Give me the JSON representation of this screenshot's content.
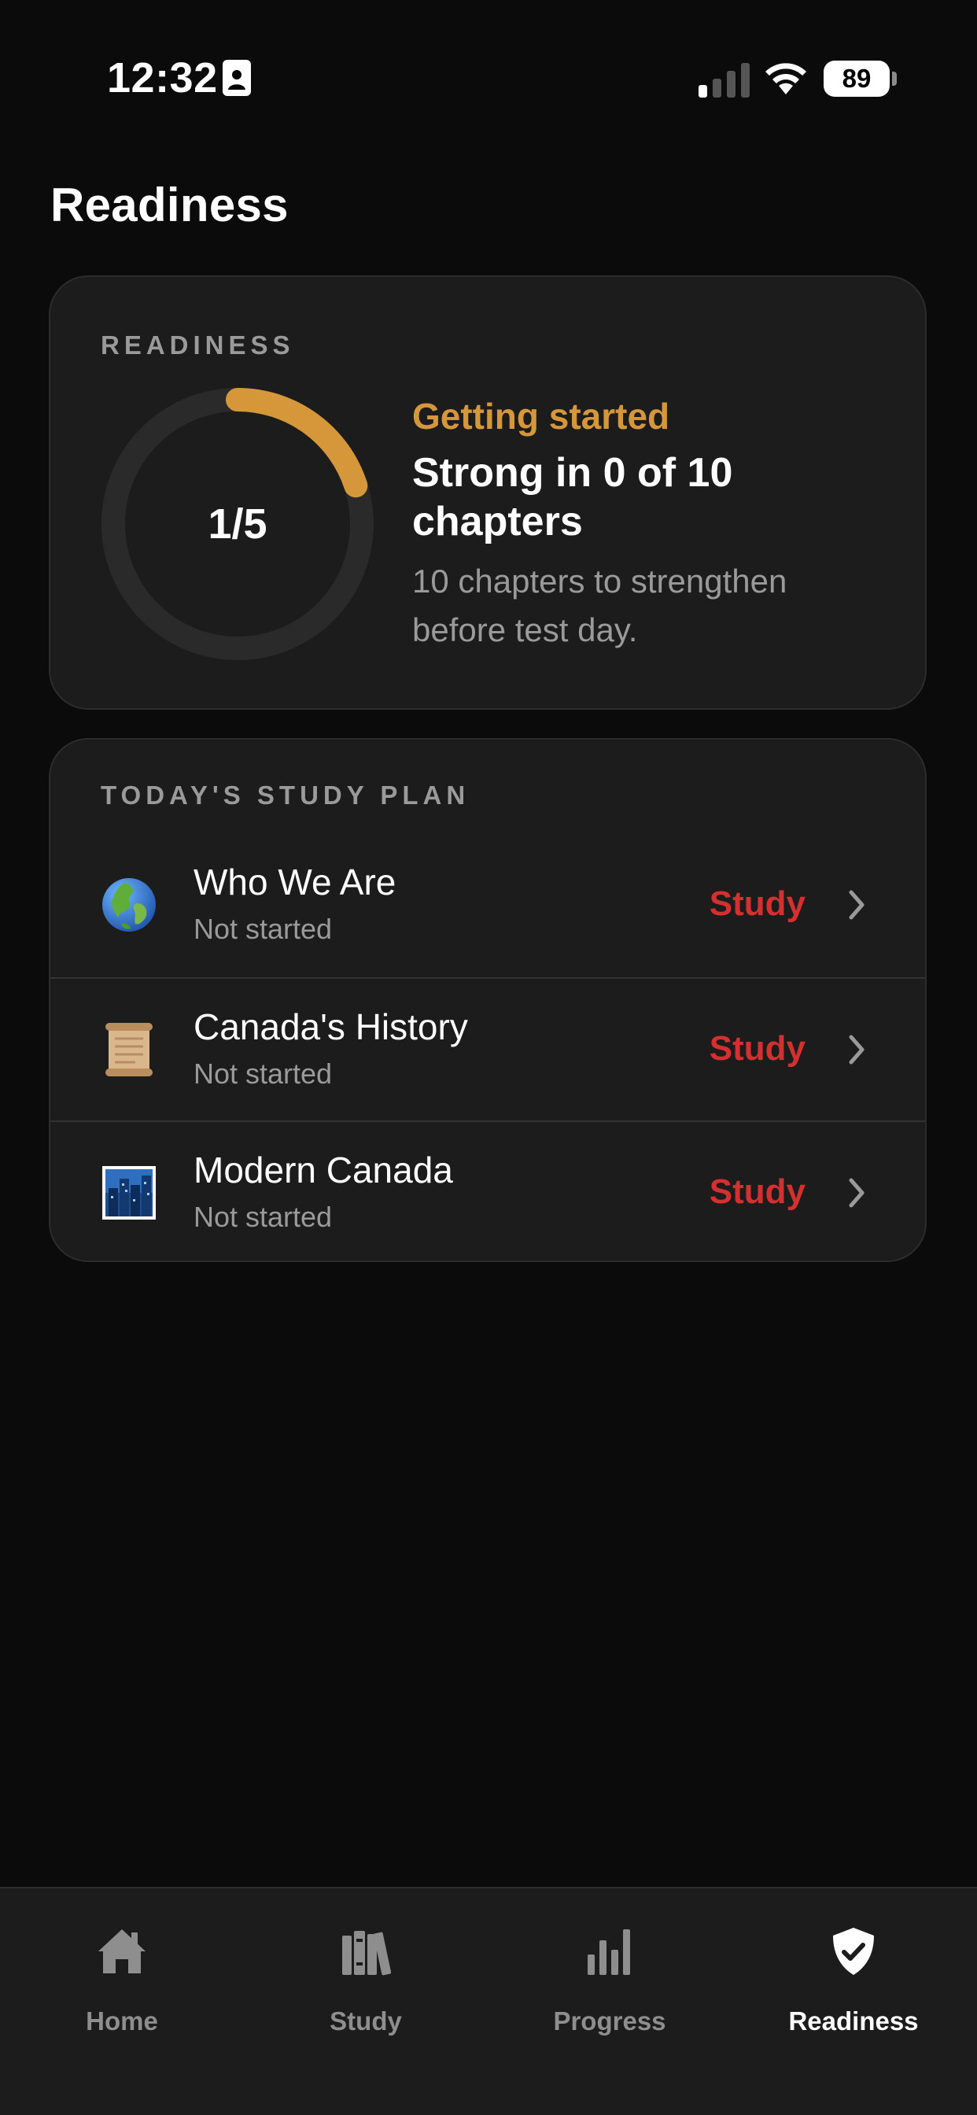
{
  "status_bar": {
    "time": "12:32",
    "battery": "89"
  },
  "page": {
    "title": "Readiness"
  },
  "readiness_card": {
    "label": "READINESS",
    "ring_text": "1/5",
    "ring_fraction": 0.2,
    "status": "Getting started",
    "headline": "Strong in 0 of 10 chapters",
    "subtext": "10 chapters to strengthen before test day."
  },
  "study_plan": {
    "label": "TODAY'S STUDY PLAN",
    "items": [
      {
        "icon": "globe-icon",
        "title": "Who We Are",
        "status": "Not started",
        "action": "Study"
      },
      {
        "icon": "scroll-icon",
        "title": "Canada's History",
        "status": "Not started",
        "action": "Study"
      },
      {
        "icon": "city-icon",
        "title": "Modern Canada",
        "status": "Not started",
        "action": "Study"
      }
    ]
  },
  "tabs": [
    {
      "icon": "home-icon",
      "label": "Home",
      "active": false
    },
    {
      "icon": "books-icon",
      "label": "Study",
      "active": false
    },
    {
      "icon": "bar-chart-icon",
      "label": "Progress",
      "active": false
    },
    {
      "icon": "shield-check-icon",
      "label": "Readiness",
      "active": true
    }
  ],
  "colors": {
    "background": "#0b0b0b",
    "card": "#1c1c1c",
    "accent_gold": "#d6973a",
    "action_red": "#d62f2f",
    "muted_text": "#9a9a9a"
  }
}
